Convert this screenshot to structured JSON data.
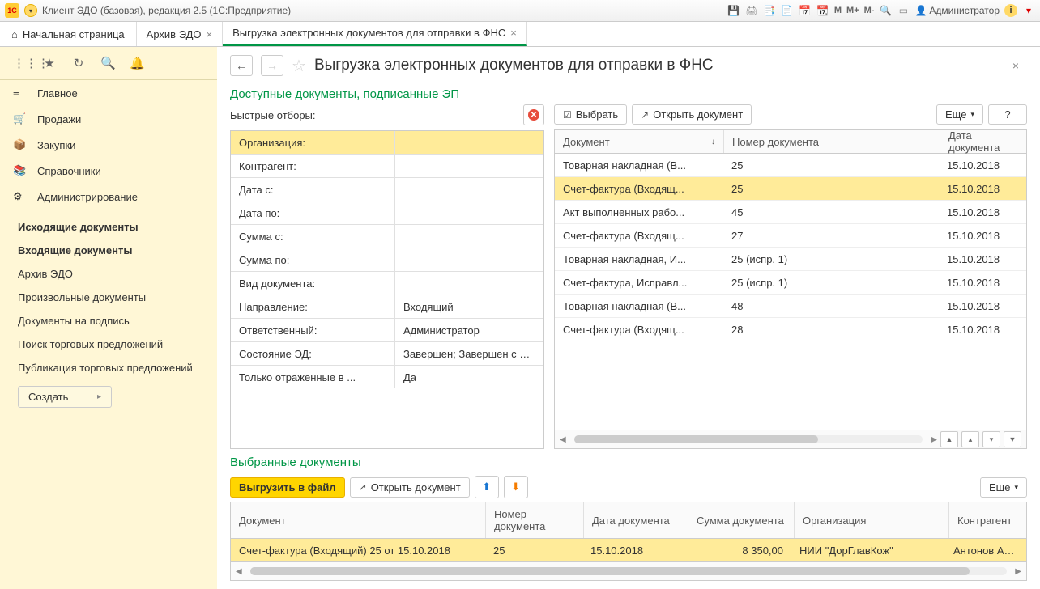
{
  "titlebar": {
    "app_title": "Клиент ЭДО (базовая), редакция 2.5  (1С:Предприятие)",
    "m": "M",
    "m_plus": "M+",
    "m_minus": "M-",
    "user": "Администратор"
  },
  "tabs": {
    "home": "Начальная страница",
    "items": [
      {
        "label": "Архив ЭДО"
      },
      {
        "label": "Выгрузка электронных документов для отправки в ФНС",
        "active": true
      }
    ]
  },
  "sidebar": {
    "main": "Главное",
    "sales": "Продажи",
    "purchases": "Закупки",
    "refs": "Справочники",
    "admin": "Администрирование",
    "links": [
      {
        "label": "Исходящие документы",
        "bold": true
      },
      {
        "label": "Входящие документы",
        "bold": true
      },
      {
        "label": "Архив ЭДО"
      },
      {
        "label": "Произвольные документы"
      },
      {
        "label": "Документы на подпись"
      },
      {
        "label": "Поиск торговых предложений"
      },
      {
        "label": "Публикация торговых предложений"
      }
    ],
    "create": "Создать"
  },
  "page": {
    "title": "Выгрузка электронных документов для отправки в ФНС",
    "section1": "Доступные документы, подписанные ЭП",
    "filters_label": "Быстрые отборы:",
    "filters": [
      {
        "k": "Организация:",
        "v": "",
        "sel": true
      },
      {
        "k": "Контрагент:",
        "v": ""
      },
      {
        "k": "Дата с:",
        "v": ""
      },
      {
        "k": "Дата по:",
        "v": ""
      },
      {
        "k": "Сумма с:",
        "v": ""
      },
      {
        "k": "Сумма по:",
        "v": ""
      },
      {
        "k": "Вид документа:",
        "v": ""
      },
      {
        "k": "Направление:",
        "v": "Входящий"
      },
      {
        "k": "Ответственный:",
        "v": "Администратор"
      },
      {
        "k": "Состояние ЭД:",
        "v": "Завершен; Завершен с ис..."
      },
      {
        "k": "Только отраженные в ...",
        "v": "Да"
      }
    ],
    "btn_select": "Выбрать",
    "btn_open": "Открыть документ",
    "btn_more": "Еще",
    "btn_help": "?",
    "th_doc": "Документ",
    "th_num": "Номер документа",
    "th_date": "Дата документа",
    "rows": [
      {
        "doc": "Товарная накладная (В...",
        "num": "25",
        "date": "15.10.2018"
      },
      {
        "doc": "Счет-фактура (Входящ...",
        "num": "25",
        "date": "15.10.2018",
        "sel": true
      },
      {
        "doc": "Акт выполненных рабо...",
        "num": "45",
        "date": "15.10.2018"
      },
      {
        "doc": "Счет-фактура (Входящ...",
        "num": "27",
        "date": "15.10.2018"
      },
      {
        "doc": "Товарная накладная, И...",
        "num": "25 (испр. 1)",
        "date": "15.10.2018"
      },
      {
        "doc": "Счет-фактура, Исправл...",
        "num": "25 (испр. 1)",
        "date": "15.10.2018"
      },
      {
        "doc": "Товарная накладная (В...",
        "num": "48",
        "date": "15.10.2018"
      },
      {
        "doc": "Счет-фактура (Входящ...",
        "num": "28",
        "date": "15.10.2018"
      }
    ],
    "section2": "Выбранные документы",
    "btn_export": "Выгрузить в файл",
    "th2_doc": "Документ",
    "th2_num": "Номер документа",
    "th2_date": "Дата документа",
    "th2_sum": "Сумма документа",
    "th2_org": "Организация",
    "th2_ka": "Контрагент",
    "rows2": [
      {
        "doc": "Счет-фактура (Входящий) 25 от 15.10.2018",
        "num": "25",
        "date": "15.10.2018",
        "sum": "8 350,00",
        "org": "НИИ \"ДорГлавКож\"",
        "ka": "Антонов Антон Антонович",
        "sel": true
      }
    ]
  }
}
